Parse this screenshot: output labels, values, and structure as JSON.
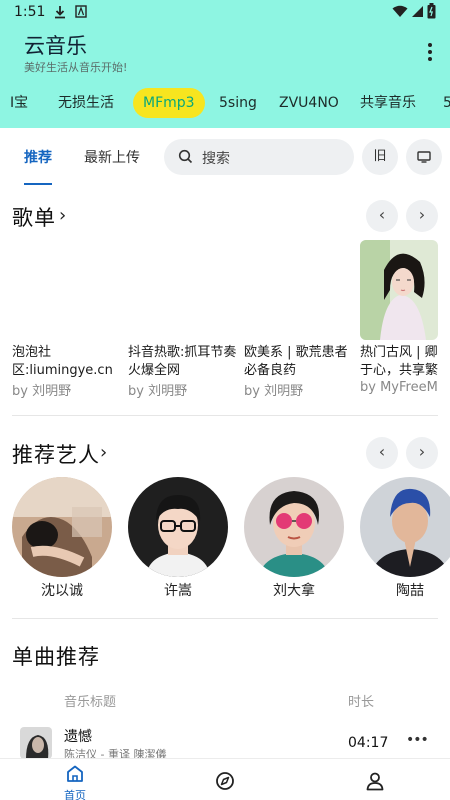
{
  "status": {
    "time": "1:51"
  },
  "app": {
    "title": "云音乐",
    "subtitle": "美好生活从音乐开始!"
  },
  "sources": [
    {
      "label": "I宝",
      "active": false
    },
    {
      "label": "无损生活",
      "active": false
    },
    {
      "label": "MFmp3",
      "active": true
    },
    {
      "label": "5sing",
      "active": false
    },
    {
      "label": "ZVU4NO",
      "active": false
    },
    {
      "label": "共享音乐",
      "active": false
    },
    {
      "label": "5",
      "active": false
    }
  ],
  "tabs": [
    {
      "label": "推荐",
      "active": true
    },
    {
      "label": "最新上传",
      "active": false
    }
  ],
  "search": {
    "placeholder": "搜索"
  },
  "actions": {
    "old_label": "旧"
  },
  "playlists": {
    "title": "歌单",
    "items": [
      {
        "name": "泡泡社区:liumingye.cn",
        "by": "by 刘明野"
      },
      {
        "name": "抖音热歌:抓耳节奏火爆全网",
        "by": "by 刘明野"
      },
      {
        "name": "欧美系 | 歌荒患者必备良药",
        "by": "by 刘明野"
      },
      {
        "name": "热门古风 | 卿于心，共享繁",
        "by": "by MyFreeM"
      }
    ]
  },
  "artists": {
    "title": "推荐艺人",
    "items": [
      {
        "name": "沈以诚"
      },
      {
        "name": "许嵩"
      },
      {
        "name": "刘大拿"
      },
      {
        "name": "陶喆"
      }
    ]
  },
  "songs": {
    "title": "单曲推荐",
    "col_title": "音乐标题",
    "col_duration": "时长",
    "items": [
      {
        "title": "遗憾",
        "artist": "陈洁仪 - 重译 陳潔儀",
        "duration": "04:17"
      }
    ]
  },
  "bottom_nav": {
    "home_label": "首页"
  },
  "colors": {
    "header_bg": "#8ef5e2",
    "active_chip": "#f7e51f",
    "accent": "#1565c0"
  }
}
